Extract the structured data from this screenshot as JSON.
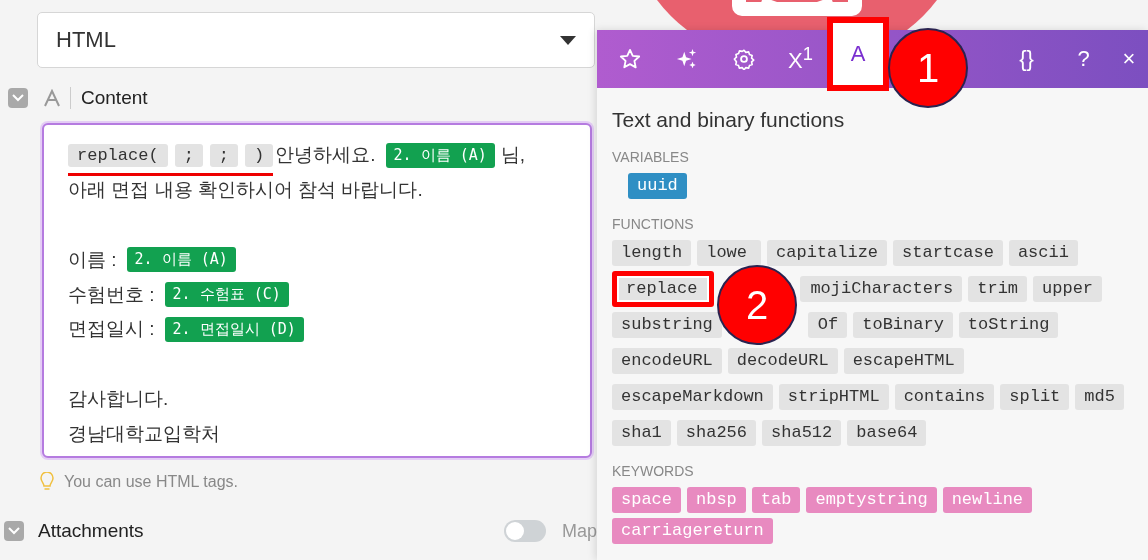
{
  "format_select": {
    "value": "HTML"
  },
  "content": {
    "label": "Content",
    "expanded": true,
    "lines": [
      {
        "kind": "text",
        "segments": [
          {
            "kind": "group",
            "marked": true,
            "items": [
              {
                "kind": "func",
                "text": "replace("
              },
              {
                "kind": "func",
                "text": ";"
              },
              {
                "kind": "func",
                "text": ";"
              },
              {
                "kind": "func",
                "text": ")"
              }
            ]
          },
          {
            "kind": "text",
            "text": "안녕하세요."
          },
          {
            "kind": "var",
            "text": "2. 이름 (A)"
          },
          {
            "kind": "text",
            "text": "님,"
          }
        ]
      },
      {
        "kind": "text",
        "segments": [
          {
            "kind": "text",
            "text": "아래 면접 내용 확인하시어 참석 바랍니다."
          }
        ]
      },
      {
        "kind": "blank"
      },
      {
        "kind": "text",
        "segments": [
          {
            "kind": "text",
            "text": "이름 :"
          },
          {
            "kind": "var",
            "text": "2. 이름 (A)"
          }
        ]
      },
      {
        "kind": "text",
        "segments": [
          {
            "kind": "text",
            "text": "수험번호 :"
          },
          {
            "kind": "var",
            "text": "2. 수험표 (C)"
          }
        ]
      },
      {
        "kind": "text",
        "segments": [
          {
            "kind": "text",
            "text": "면접일시 :"
          },
          {
            "kind": "var",
            "text": "2. 면접일시 (D)"
          }
        ]
      },
      {
        "kind": "blank"
      },
      {
        "kind": "text",
        "segments": [
          {
            "kind": "text",
            "text": "감사합니다."
          }
        ]
      },
      {
        "kind": "text",
        "segments": [
          {
            "kind": "text",
            "text": "경남대학교입학처"
          }
        ]
      }
    ],
    "hint": "You can use HTML tags."
  },
  "attachments": {
    "label": "Attachments",
    "expanded": true,
    "map_toggle": {
      "on": false,
      "label": "Map"
    }
  },
  "panel": {
    "tabs": [
      {
        "kind": "star",
        "selected": false,
        "highlighted": false
      },
      {
        "kind": "sparkle",
        "selected": false,
        "highlighted": false
      },
      {
        "kind": "gear",
        "selected": false,
        "highlighted": false
      },
      {
        "kind": "text",
        "label": "X$^{1}$",
        "selected": false,
        "highlighted": false
      },
      {
        "kind": "text",
        "label": "A",
        "selected": true,
        "highlighted": true
      },
      {
        "kind": "covered"
      },
      {
        "kind": "text",
        "label": "{}",
        "selected": false,
        "highlighted": false
      },
      {
        "kind": "text",
        "label": "?",
        "selected": false,
        "highlighted": false
      },
      {
        "kind": "text",
        "label": "×",
        "selected": false,
        "highlighted": false
      }
    ],
    "title": "Text and binary functions",
    "variables_heading": "VARIABLES",
    "variables": [
      {
        "text": "uuid"
      }
    ],
    "functions_heading": "FUNCTIONS",
    "functions": [
      {
        "kind": "chip",
        "text": "length",
        "highlighted": false
      },
      {
        "kind": "cut_right",
        "text": "lowe",
        "highlighted": false
      },
      {
        "kind": "chip",
        "text": "capitalize",
        "highlighted": false
      },
      {
        "kind": "chip",
        "text": "startcase",
        "highlighted": false
      },
      {
        "kind": "chip",
        "text": "ascii",
        "highlighted": false
      },
      {
        "kind": "chip",
        "text": "replace",
        "highlighted": true
      },
      {
        "kind": "cut_left",
        "text": "mojiCharacters",
        "highlighted": false
      },
      {
        "kind": "chip",
        "text": "trim",
        "highlighted": false
      },
      {
        "kind": "chip",
        "text": "upper",
        "highlighted": false
      },
      {
        "kind": "chip",
        "text": "substring",
        "highlighted": false
      },
      {
        "kind": "cut_left",
        "text": "Of",
        "highlighted": false
      },
      {
        "kind": "chip",
        "text": "toBinary",
        "highlighted": false
      },
      {
        "kind": "chip",
        "text": "toString",
        "highlighted": false
      },
      {
        "kind": "chip",
        "text": "encodeURL",
        "highlighted": false
      },
      {
        "kind": "chip",
        "text": "decodeURL",
        "highlighted": false
      },
      {
        "kind": "chip",
        "text": "escapeHTML",
        "highlighted": false
      },
      {
        "kind": "chip",
        "text": "escapeMarkdown",
        "highlighted": false
      },
      {
        "kind": "chip",
        "text": "stripHTML",
        "highlighted": false
      },
      {
        "kind": "chip",
        "text": "contains",
        "highlighted": false
      },
      {
        "kind": "chip",
        "text": "split",
        "highlighted": false
      },
      {
        "kind": "chip",
        "text": "md5",
        "highlighted": false
      },
      {
        "kind": "chip",
        "text": "sha1",
        "highlighted": false
      },
      {
        "kind": "chip",
        "text": "sha256",
        "highlighted": false
      },
      {
        "kind": "chip",
        "text": "sha512",
        "highlighted": false
      },
      {
        "kind": "chip",
        "text": "base64",
        "highlighted": false
      }
    ],
    "keywords_heading": "KEYWORDS",
    "keywords": [
      {
        "text": "space"
      },
      {
        "text": "nbsp"
      },
      {
        "text": "tab"
      },
      {
        "text": "emptystring"
      },
      {
        "text": "newline"
      },
      {
        "text": "carriagereturn"
      }
    ]
  },
  "callouts": [
    {
      "label": "1"
    },
    {
      "label": "2"
    }
  ]
}
